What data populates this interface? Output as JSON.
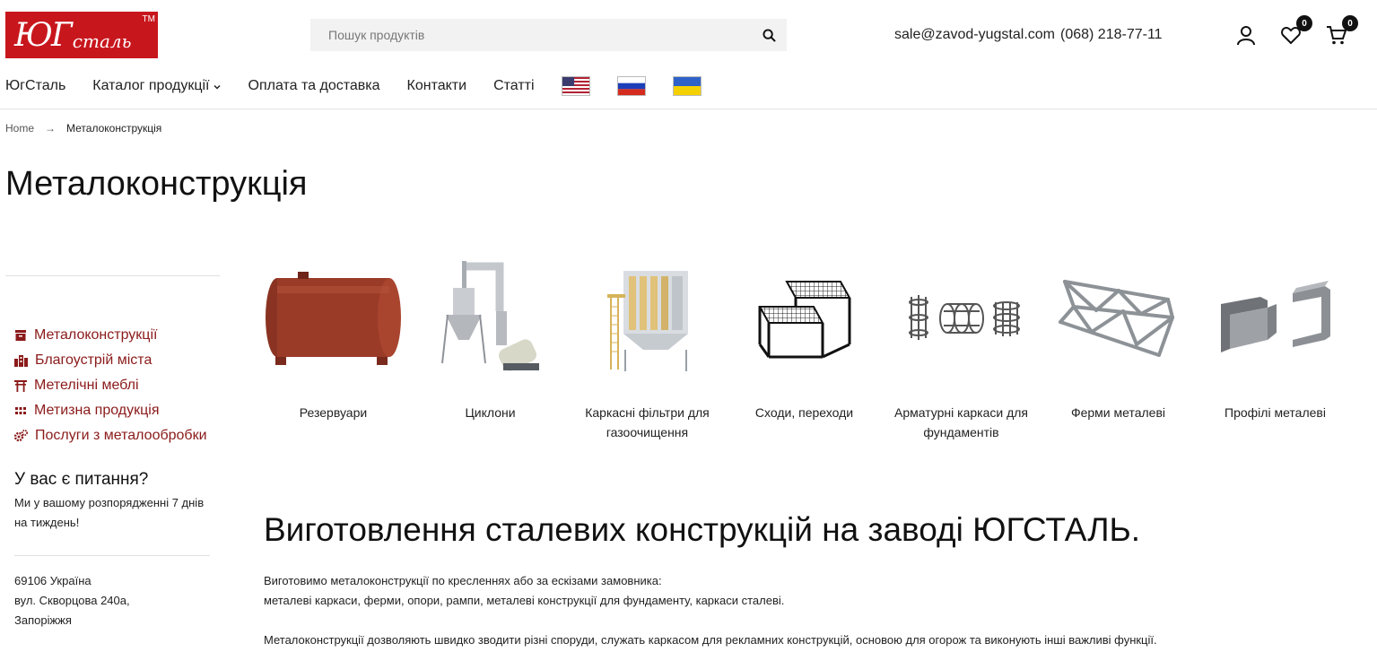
{
  "header": {
    "logo_text_big": "ЮГ",
    "logo_text_small": "сталь",
    "logo_tm": "TM",
    "search_placeholder": "Пошук продуктів",
    "email": "sale@zavod-yugstal.com",
    "phone": "(068) 218-77-11",
    "wishlist_count": "0",
    "cart_count": "0"
  },
  "nav": {
    "items": [
      "ЮгСталь",
      "Каталог продукції",
      "Оплата та доставка",
      "Контакти",
      "Статті"
    ],
    "dropdown_arrow": "⌄"
  },
  "breadcrumb": {
    "home": "Home",
    "arrow": "→",
    "current": "Металоконструкція"
  },
  "page_title": "Металоконструкція",
  "sidebar": {
    "categories": [
      {
        "label": "Металоконструкції",
        "icon": "archive-icon"
      },
      {
        "label": "Благоустрій міста",
        "icon": "city-icon"
      },
      {
        "label": "Метелічні меблі",
        "icon": "torii-icon"
      },
      {
        "label": "Метизна продукція",
        "icon": "grid-dots-icon"
      },
      {
        "label": "Послуги з металообробки",
        "icon": "gears-icon"
      }
    ],
    "question_title": "У вас є питання?",
    "question_text": "Ми у вашому розпорядженні 7 днів на тиждень!",
    "address": [
      "69106 Україна",
      "вул. Скворцова 240а,",
      "Запоріжжя"
    ]
  },
  "products": [
    {
      "name": "Резервуари"
    },
    {
      "name": "Циклони"
    },
    {
      "name": "Каркасні фільтри для газоочищення"
    },
    {
      "name": "Сходи, переходи"
    },
    {
      "name": "Арматурні каркаси для фундаментів"
    },
    {
      "name": "Ферми металеві"
    },
    {
      "name": "Профілі металеві"
    }
  ],
  "content": {
    "heading": "Виготовлення сталевих конструкцій на заводі ЮГСТАЛЬ.",
    "p1_line1": "Виготовимо металоконструкції по кресленнях або за ескізами замовника:",
    "p1_line2": "металеві каркаси, ферми, опори, рампи, металеві конструкції для фундаменту, каркаси сталеві.",
    "p2": "Металоконструкції дозволяють швидко зводити різні споруди, служать каркасом для рекламних конструкцій, основою для огорож та виконують інші важливі функції."
  },
  "colors": {
    "brand": "#c8161d",
    "link": "#8b1a1a"
  }
}
